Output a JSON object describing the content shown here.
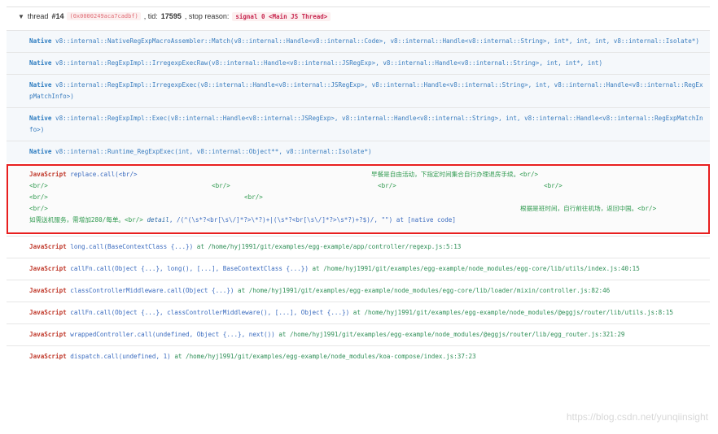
{
  "thread": {
    "prefix": "thread",
    "number": "#14",
    "address": "(0x0000249aca7cadbf)",
    "tid_label": ", tid:",
    "tid": "17595",
    "reason_label": ", stop reason:",
    "signal": "signal 0 <Main JS Thread>"
  },
  "frames": [
    {
      "kind": "Native",
      "text": "v8::internal::NativeRegExpMacroAssembler::Match(v8::internal::Handle<v8::internal::Code>, v8::internal::Handle<v8::internal::String>, int*, int, int, v8::internal::Isolate*)"
    },
    {
      "kind": "Native",
      "text": "v8::internal::RegExpImpl::IrregexpExecRaw(v8::internal::Handle<v8::internal::JSRegExp>, v8::internal::Handle<v8::internal::String>, int, int*, int)"
    },
    {
      "kind": "Native",
      "text": "v8::internal::RegExpImpl::IrregexpExec(v8::internal::Handle<v8::internal::JSRegExp>, v8::internal::Handle<v8::internal::String>, int, v8::internal::Handle<v8::internal::RegExpMatchInfo>)"
    },
    {
      "kind": "Native",
      "text": "v8::internal::RegExpImpl::Exec(v8::internal::Handle<v8::internal::JSRegExp>, v8::internal::Handle<v8::internal::String>, int, v8::internal::Handle<v8::internal::RegExpMatchInfo>)"
    },
    {
      "kind": "Native",
      "text": "v8::internal::Runtime_RegExpExec(int, v8::internal::Object**, v8::internal::Isolate*)"
    }
  ],
  "highlight": {
    "line1_kind": "JavaScript",
    "line1_call": "replace.call(<br/>",
    "line1_right": "早餐是自由活动，下指定时间集合自行办理退房手续。<br/>",
    "line2": [
      "<br/>",
      "<br/>",
      "<br/>",
      "<br/>"
    ],
    "line3": [
      "<br/>",
      "<br/>"
    ],
    "line4_left": "<br/>",
    "line4_right": "根据是班时间，自行前往机场，返回中国。<br/>",
    "line5_left": "如需送机服务，需增加280/每单。<br/>",
    "line5_fn": "detail",
    "line5_rest": ", /(^(\\s*?<br[\\s\\/]*?>\\*?)+|(\\s*?<br[\\s\\/]*?>\\s*?)+?$)/, \"\") at [native code]"
  },
  "js_frames": [
    {
      "kind": "JavaScript",
      "call": "long.call(BaseContextClass {...})",
      "at": "at /home/hyj1991/git/examples/egg-example/app/controller/regexp.js:5:13"
    },
    {
      "kind": "JavaScript",
      "call": "callFn.call(Object {...}, long(), [...], BaseContextClass {...})",
      "at": "at /home/hyj1991/git/examples/egg-example/node_modules/egg-core/lib/utils/index.js:40:15"
    },
    {
      "kind": "JavaScript",
      "call": "classControllerMiddleware.call(Object {...})",
      "at": "at /home/hyj1991/git/examples/egg-example/node_modules/egg-core/lib/loader/mixin/controller.js:82:46"
    },
    {
      "kind": "JavaScript",
      "call": "callFn.call(Object {...}, classControllerMiddleware(), [...], Object {...})",
      "at": "at /home/hyj1991/git/examples/egg-example/node_modules/@eggjs/router/lib/utils.js:8:15"
    },
    {
      "kind": "JavaScript",
      "call": "wrappedController.call(undefined, Object {...}, next())",
      "at": "at /home/hyj1991/git/examples/egg-example/node_modules/@eggjs/router/lib/egg_router.js:321:29"
    },
    {
      "kind": "JavaScript",
      "call": "dispatch.call(undefined, 1)",
      "at": "at /home/hyj1991/git/examples/egg-example/node_modules/koa-compose/index.js:37:23"
    }
  ],
  "watermark": "https://blog.csdn.net/yunqiinsight"
}
